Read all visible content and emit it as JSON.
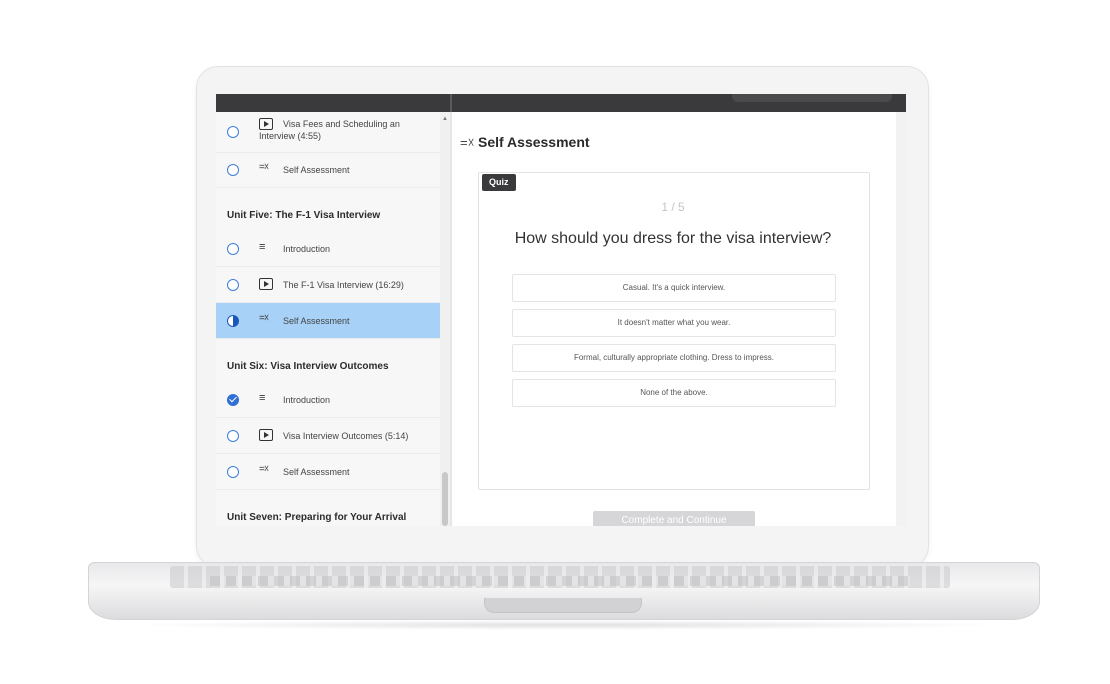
{
  "sidebar": {
    "rows": [
      {
        "label": "Visa Fees and Scheduling an Interview (4:55)",
        "type": "video",
        "status": "empty"
      },
      {
        "label": "Self Assessment",
        "type": "quiz",
        "status": "empty"
      }
    ],
    "unit5": {
      "title": "Unit Five: The F-1 Visa Interview",
      "rows": [
        {
          "label": "Introduction",
          "type": "text",
          "status": "empty"
        },
        {
          "label": "The F-1 Visa Interview (16:29)",
          "type": "video",
          "status": "empty"
        },
        {
          "label": "Self Assessment",
          "type": "quiz",
          "status": "in-progress"
        }
      ]
    },
    "unit6": {
      "title": "Unit Six: Visa Interview Outcomes",
      "rows": [
        {
          "label": "Introduction",
          "type": "text",
          "status": "complete"
        },
        {
          "label": "Visa Interview Outcomes (5:14)",
          "type": "video",
          "status": "empty"
        },
        {
          "label": "Self Assessment",
          "type": "quiz",
          "status": "empty"
        }
      ]
    },
    "unit7": {
      "title": "Unit Seven: Preparing for Your Arrival"
    }
  },
  "main": {
    "title": "Self Assessment",
    "badge": "Quiz",
    "counter": "1 / 5",
    "question": "How should you dress for the visa interview?",
    "options": [
      "Casual. It's a quick interview.",
      "It doesn't matter what you wear.",
      "Formal, culturally appropriate clothing. Dress to impress.",
      "None of the above."
    ],
    "complete_button": "Complete and Continue"
  },
  "icons": {
    "video": "play-icon",
    "text": "text-lines-icon",
    "quiz": "quiz-icon"
  },
  "colors": {
    "accent": "#2f6fd6",
    "active_row": "#a7d1f7",
    "topbar": "#3a3a3c"
  }
}
